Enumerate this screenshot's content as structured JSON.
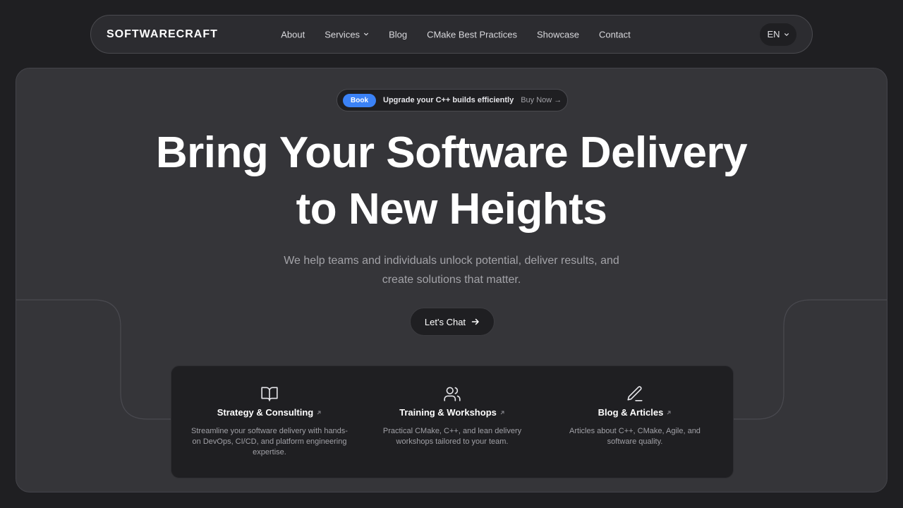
{
  "nav": {
    "brand": "SOFTWARECRAFT",
    "links": [
      {
        "label": "About"
      },
      {
        "label": "Services"
      },
      {
        "label": "Blog"
      },
      {
        "label": "CMake Best Practices"
      },
      {
        "label": "Showcase"
      },
      {
        "label": "Contact"
      }
    ],
    "lang": "EN"
  },
  "promo": {
    "badge": "Book",
    "text": "Upgrade your C++ builds efficiently",
    "cta": "Buy Now →"
  },
  "hero": {
    "headline_line1": "Bring Your Software Delivery",
    "headline_line2": "to New Heights",
    "sub_line1": "We help teams and individuals unlock potential, deliver results, and",
    "sub_line2": "create solutions that matter.",
    "cta": "Let's Chat"
  },
  "cards": [
    {
      "icon": "book-open-icon",
      "title": "Strategy & Consulting",
      "desc_lines": [
        "Streamline your software delivery with hands-",
        "on DevOps, CI/CD, and platform engineering",
        "expertise."
      ]
    },
    {
      "icon": "users-icon",
      "title": "Training & Workshops",
      "desc_lines": [
        "Practical CMake, C++, and lean delivery",
        "workshops tailored to your team."
      ]
    },
    {
      "icon": "pencil-icon",
      "title": "Blog & Articles",
      "desc_lines": [
        "Articles about C++, CMake, Agile, and",
        "software quality."
      ]
    }
  ],
  "colors": {
    "background": "#1f1f22",
    "panel": "#353539",
    "accent": "#3b82f6",
    "text": "#ffffff",
    "muted": "#a3a3a8"
  }
}
